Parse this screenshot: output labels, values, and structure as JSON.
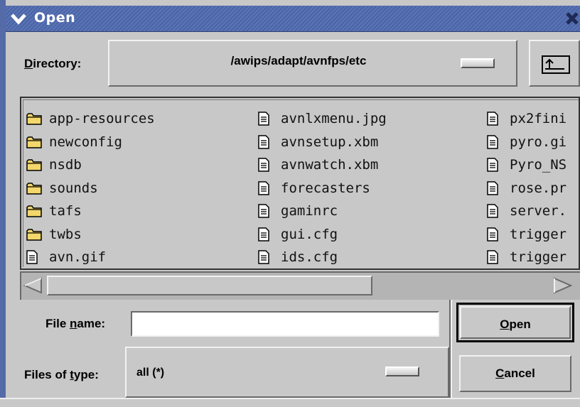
{
  "window": {
    "title": "Open",
    "menu_icon": "chevron-down-icon",
    "close_icon": "close-icon"
  },
  "directory": {
    "label_prefix": "",
    "label_mnemonic": "D",
    "label_rest": "irectory:",
    "path": "/awips/adapt/avnfps/etc",
    "up_icon": "folder-up-icon"
  },
  "files": {
    "columns": [
      [
        {
          "name": "app-resources",
          "type": "folder"
        },
        {
          "name": "newconfig",
          "type": "folder"
        },
        {
          "name": "nsdb",
          "type": "folder"
        },
        {
          "name": "sounds",
          "type": "folder"
        },
        {
          "name": "tafs",
          "type": "folder"
        },
        {
          "name": "twbs",
          "type": "folder"
        },
        {
          "name": "avn.gif",
          "type": "file"
        }
      ],
      [
        {
          "name": "avnlxmenu.jpg",
          "type": "file"
        },
        {
          "name": "avnsetup.xbm",
          "type": "file"
        },
        {
          "name": "avnwatch.xbm",
          "type": "file"
        },
        {
          "name": "forecasters",
          "type": "file"
        },
        {
          "name": "gaminrc",
          "type": "file"
        },
        {
          "name": "gui.cfg",
          "type": "file"
        },
        {
          "name": "ids.cfg",
          "type": "file"
        }
      ],
      [
        {
          "name": "px2fini",
          "type": "file"
        },
        {
          "name": "pyro.gi",
          "type": "file"
        },
        {
          "name": "Pyro_NS",
          "type": "file"
        },
        {
          "name": "rose.pr",
          "type": "file"
        },
        {
          "name": "server.",
          "type": "file"
        },
        {
          "name": "trigger",
          "type": "file"
        },
        {
          "name": "trigger",
          "type": "file"
        }
      ]
    ]
  },
  "filename": {
    "label_prefix": "File ",
    "label_mnemonic": "n",
    "label_rest": "ame:",
    "value": ""
  },
  "filetype": {
    "label_prefix": "Files of ",
    "label_mnemonic": "t",
    "label_rest": "ype:",
    "selected": "all (*)"
  },
  "buttons": {
    "open_mnemonic": "O",
    "open_rest": "pen",
    "cancel_mnemonic": "C",
    "cancel_rest": "ancel"
  },
  "colors": {
    "titlebar": "#4a64a6",
    "window_bg": "#c8c8c8",
    "folder_fill": "#f3d76a"
  }
}
